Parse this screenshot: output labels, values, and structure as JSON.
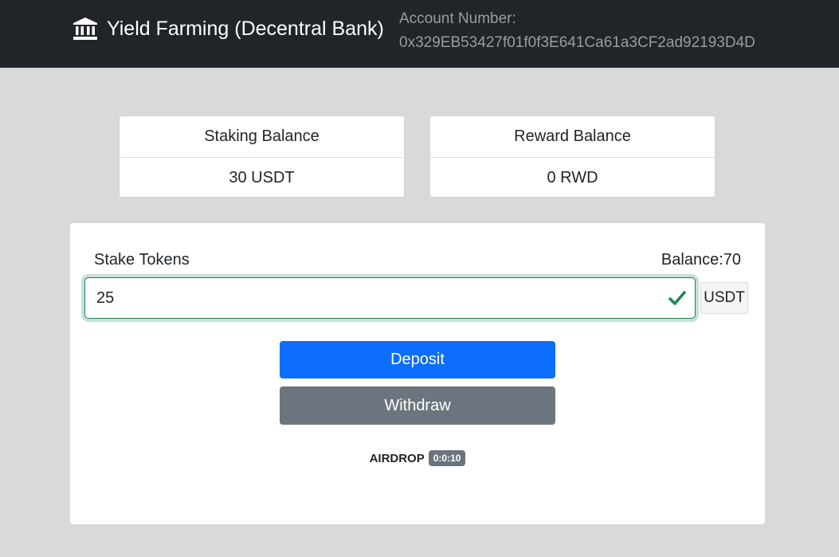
{
  "header": {
    "brand_icon": "bank-icon",
    "title": "Yield Farming (Decentral Bank)",
    "account_label": "Account Number:",
    "account_number": "0x329EB53427f01f0f3E641Ca61a3CF2ad92193D4D"
  },
  "staking_card": {
    "title": "Staking Balance",
    "value": "30 USDT"
  },
  "reward_card": {
    "title": "Reward Balance",
    "value": "0 RWD"
  },
  "stake_form": {
    "label": "Stake Tokens",
    "balance": "Balance:70",
    "amount": "25",
    "valid_icon": "check-icon",
    "currency": "USDT",
    "deposit_label": "Deposit",
    "withdraw_label": "Withdraw"
  },
  "airdrop": {
    "label": "AIRDROP",
    "timer": "0:0:10"
  },
  "colors": {
    "navbar": "#212529",
    "page_background": "#d9d9d9",
    "primary": "#0d6efd",
    "secondary": "#6c757d",
    "success": "#198754"
  }
}
